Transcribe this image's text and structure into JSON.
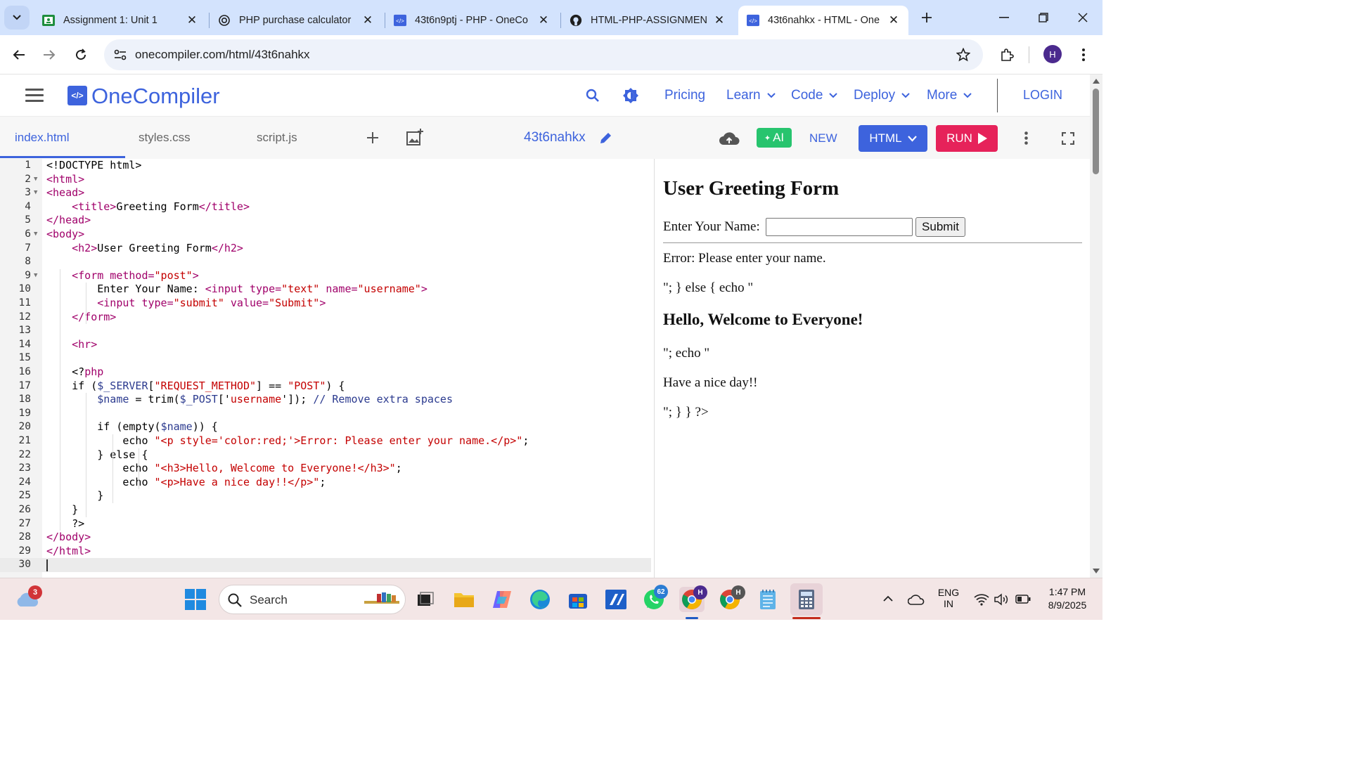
{
  "browser": {
    "tabs": [
      {
        "title": "Assignment 1: Unit 1",
        "icon": "google-classroom-icon",
        "active": false
      },
      {
        "title": "PHP purchase calculator",
        "icon": "chatgpt-icon",
        "active": false
      },
      {
        "title": "43t6n9ptj - PHP - OneCo",
        "icon": "onecompiler-icon",
        "active": false
      },
      {
        "title": "HTML-PHP-ASSIGNMENT",
        "icon": "github-icon",
        "active": false
      },
      {
        "title": "43t6nahkx - HTML - One",
        "icon": "onecompiler-icon",
        "active": true
      }
    ],
    "url": "onecompiler.com/html/43t6nahkx",
    "profile_initial": "H"
  },
  "site": {
    "logo_mark": "</>",
    "logo_text": "OneCompiler",
    "nav": {
      "pricing": "Pricing",
      "learn": "Learn",
      "code": "Code",
      "deploy": "Deploy",
      "more": "More",
      "login": "LOGIN"
    }
  },
  "editor": {
    "files": [
      "index.html",
      "styles.css",
      "script.js"
    ],
    "active_file": "index.html",
    "project_id": "43t6nahkx",
    "ai_label": "AI",
    "new_label": "NEW",
    "language_label": "HTML",
    "run_label": "RUN",
    "current_line": 30,
    "lines": [
      "<!DOCTYPE html>",
      "<html>",
      "<head>",
      "    <title>Greeting Form</title>",
      "</head>",
      "<body>",
      "    <h2>User Greeting Form</h2>",
      "",
      "    <form method=\"post\">",
      "        Enter Your Name: <input type=\"text\" name=\"username\">",
      "        <input type=\"submit\" value=\"Submit\">",
      "    </form>",
      "",
      "    <hr>",
      "",
      "    <?php",
      "    if ($_SERVER[\"REQUEST_METHOD\"] == \"POST\") {",
      "        $name = trim($_POST['username']); // Remove extra spaces",
      "",
      "        if (empty($name)) {",
      "            echo \"<p style='color:red;'>Error: Please enter your name.</p>\";",
      "        } else {",
      "            echo \"<h3>Hello, Welcome to Everyone!</h3>\";",
      "            echo \"<p>Have a nice day!!</p>\";",
      "        }",
      "    }",
      "    ?>",
      "</body>",
      "</html>",
      ""
    ]
  },
  "preview": {
    "heading": "User Greeting Form",
    "name_label": "Enter Your Name:",
    "name_value": "",
    "submit_label": "Submit",
    "error_text": "Error: Please enter your name.",
    "text_1": "\"; } else { echo \"",
    "welcome_heading": "Hello, Welcome to Everyone!",
    "text_2": "\"; echo \"",
    "text_3": "Have a nice day!!",
    "text_4": "\"; } } ?>"
  },
  "taskbar": {
    "search_placeholder": "Search",
    "weather_badge": "3",
    "whatsapp_badge": "62",
    "language": "ENG",
    "region": "IN",
    "time": "1:47 PM",
    "date": "8/9/2025"
  },
  "colors": {
    "brand_blue": "#3d63dd",
    "run_pink": "#e6225a",
    "ai_green": "#27c46e",
    "tab_strip": "#d3e3fd"
  }
}
